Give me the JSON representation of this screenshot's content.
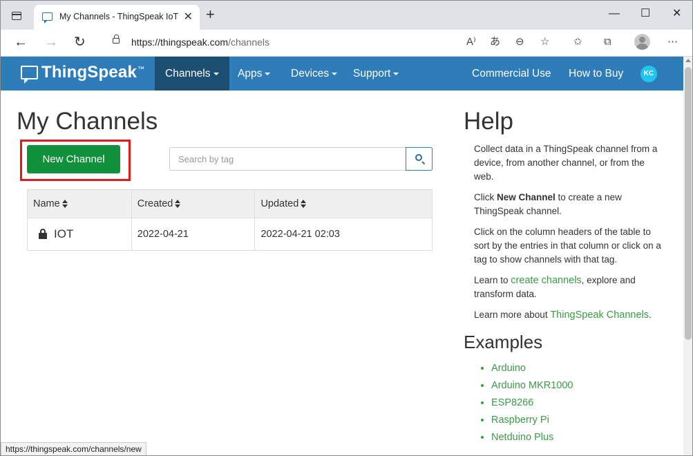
{
  "browser": {
    "tab_title": "My Channels - ThingSpeak IoT",
    "url_host": "https://thingspeak.com",
    "url_path": "/channels",
    "status_url": "https://thingspeak.com/channels/new"
  },
  "navbar": {
    "brand": "ThingSpeak",
    "brand_tm": "™",
    "items": [
      {
        "label": "Channels"
      },
      {
        "label": "Apps"
      },
      {
        "label": "Devices"
      },
      {
        "label": "Support"
      }
    ],
    "right": [
      {
        "label": "Commercial Use"
      },
      {
        "label": "How to Buy"
      }
    ],
    "avatar_initials": "KC"
  },
  "main": {
    "title": "My Channels",
    "new_channel_label": "New Channel",
    "search_placeholder": "Search by tag",
    "table": {
      "headers": [
        "Name",
        "Created",
        "Updated"
      ],
      "rows": [
        {
          "name": "IOT",
          "created": "2022-04-21",
          "updated": "2022-04-21 02:03"
        }
      ]
    }
  },
  "help": {
    "title": "Help",
    "p1": "Collect data in a ThingSpeak channel from a device, from another channel, or from the web.",
    "p2_pre": "Click ",
    "p2_bold": "New Channel",
    "p2_post": " to create a new ThingSpeak channel.",
    "p3": "Click on the column headers of the table to sort by the entries in that column or click on a tag to show channels with that tag.",
    "p4_pre": "Learn to ",
    "p4_link": "create channels",
    "p4_post": ", explore and transform data.",
    "p5_pre": "Learn more about ",
    "p5_link": "ThingSpeak Channels",
    "p5_post": ".",
    "examples_title": "Examples",
    "examples": [
      "Arduino",
      "Arduino MKR1000",
      "ESP8266",
      "Raspberry Pi",
      "Netduino Plus"
    ]
  },
  "colors": {
    "navbar": "#2e7cb8",
    "navbar_active": "#1c4e72",
    "button_green": "#12913c",
    "link_green": "#3a9a45",
    "highlight_red": "#e11b1b"
  }
}
